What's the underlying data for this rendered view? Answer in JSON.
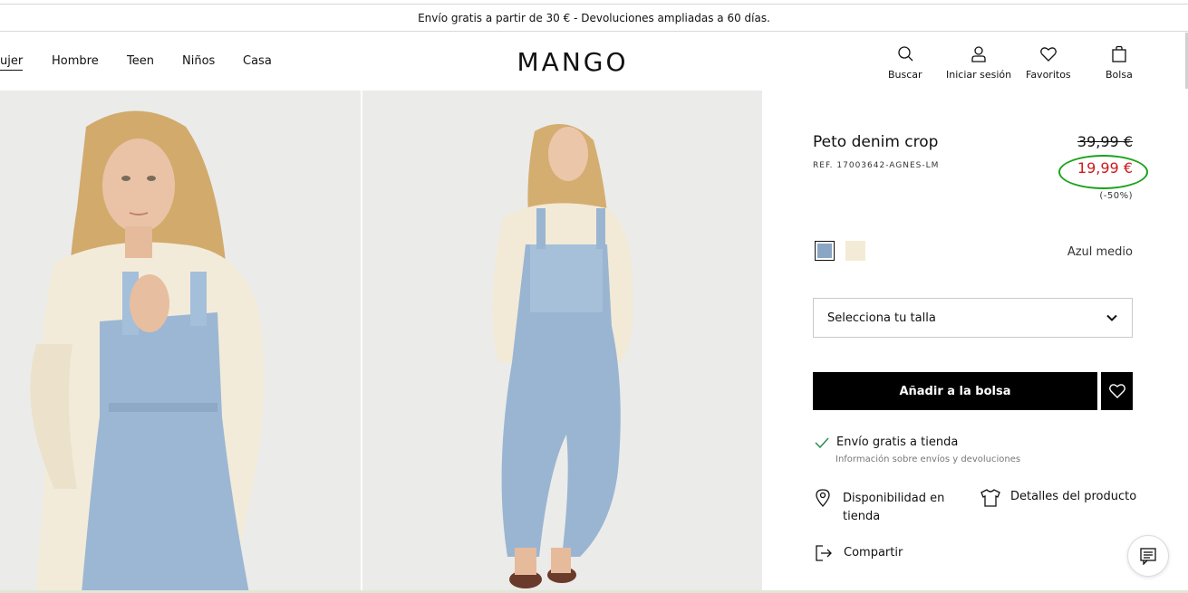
{
  "promo": {
    "text": "Envío gratis a partir de 30 € - Devoluciones ampliadas a 60 días."
  },
  "nav": {
    "items": [
      {
        "label": "ujer",
        "active": true
      },
      {
        "label": "Hombre",
        "active": false
      },
      {
        "label": "Teen",
        "active": false
      },
      {
        "label": "Niños",
        "active": false
      },
      {
        "label": "Casa",
        "active": false
      }
    ]
  },
  "logo": {
    "text": "MANGO"
  },
  "tools": {
    "search": "Buscar",
    "login": "Iniciar sesión",
    "favorites": "Favoritos",
    "bag": "Bolsa"
  },
  "product": {
    "title": "Peto denim crop",
    "ref": "REF. 17003642-AGNES-LM",
    "old_price": "39,99 €",
    "new_price": "19,99 €",
    "discount": "(-50%)",
    "color_name": "Azul medio",
    "swatches": [
      {
        "color": "#8aa6c4",
        "selected": true
      },
      {
        "color": "#f4ebd6",
        "selected": false
      }
    ],
    "size_placeholder": "Selecciona tu talla",
    "add_to_bag": "Añadir a la bolsa"
  },
  "shipping": {
    "title": "Envío gratis a tienda",
    "subtitle": "Información sobre envíos y devoluciones"
  },
  "links": {
    "availability": "Disponibilidad en tienda",
    "details": "Detalles del producto",
    "share": "Compartir"
  },
  "colors": {
    "sale_red": "#cc1b1b",
    "highlight_green": "#1aa31a",
    "button_black": "#000000"
  }
}
